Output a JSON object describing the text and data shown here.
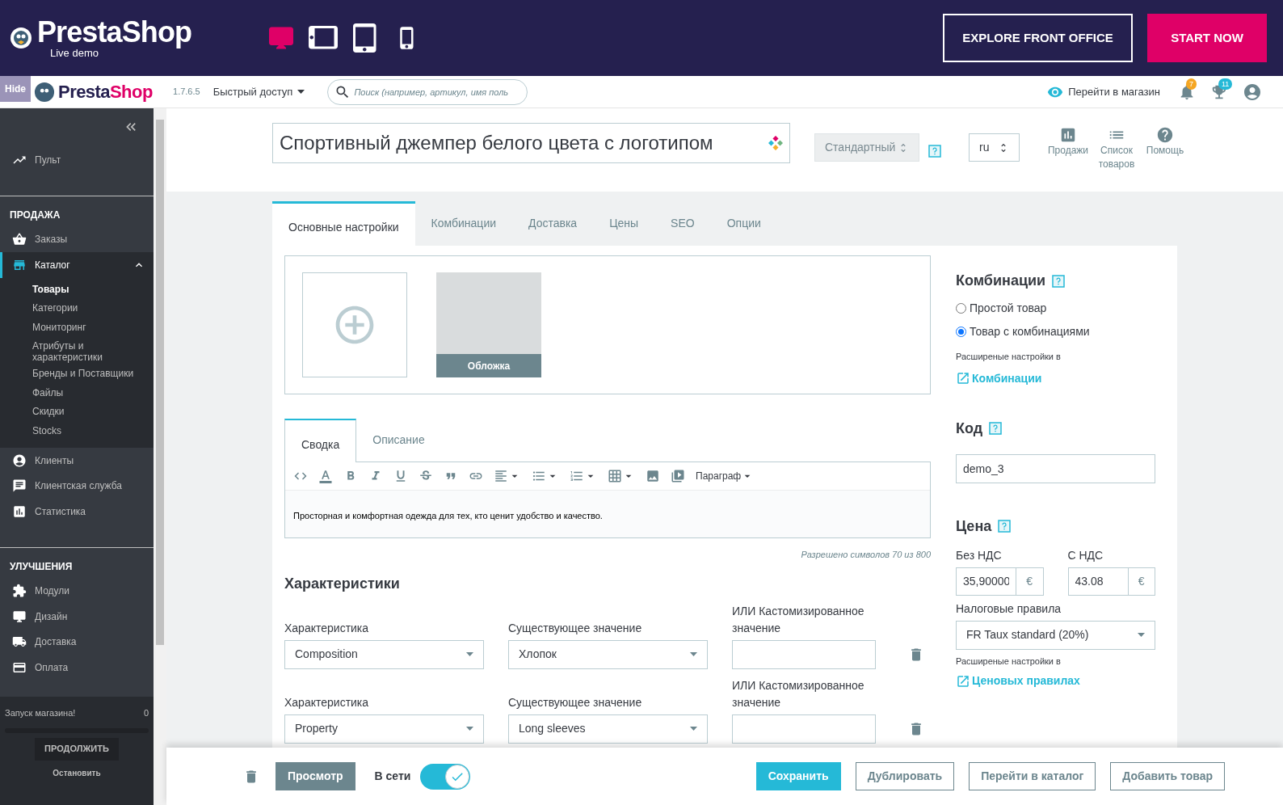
{
  "demo_bar": {
    "logo": "PrestaShop",
    "subtitle": "Live demo",
    "devices": [
      {
        "kind": "desktop",
        "selected": true
      },
      {
        "kind": "tablet-landscape",
        "selected": false
      },
      {
        "kind": "tablet",
        "selected": false
      },
      {
        "kind": "phone",
        "selected": false
      }
    ],
    "buttons": [
      {
        "label": "EXPLORE FRONT OFFICE",
        "kind": "outline"
      },
      {
        "label": "START NOW",
        "kind": "primary"
      }
    ]
  },
  "header": {
    "hide_label": "Hide",
    "logo_part1": "Presta",
    "logo_part2": "Shop",
    "version": "1.7.6.5",
    "quick_access": "Быстрый доступ",
    "search_placeholder": "Поиск (например, артикул, имя поль",
    "view_shop": "Перейти в магазин",
    "notifications": [
      {
        "kind": "bell",
        "count": "7",
        "color": "#f5a623"
      },
      {
        "kind": "trophy",
        "count": "11",
        "color": "#25b9d7"
      }
    ]
  },
  "sidebar": {
    "groups": [
      {
        "items": [
          {
            "kind": "dashboard",
            "label": "Пульт",
            "selected": false
          }
        ]
      },
      {
        "title": "ПРОДАЖА",
        "items": [
          {
            "kind": "orders",
            "label": "Заказы",
            "selected": false
          },
          {
            "kind": "catalog",
            "label": "Каталог",
            "selected": true,
            "expanded": true,
            "children": [
              {
                "label": "Товары",
                "selected": true
              },
              {
                "label": "Категории",
                "selected": false
              },
              {
                "label": "Мониторинг",
                "selected": false
              },
              {
                "label": "Атрибуты и характеристики",
                "selected": false
              },
              {
                "label": "Бренды и Поставщики",
                "selected": false
              },
              {
                "label": "Файлы",
                "selected": false
              },
              {
                "label": "Скидки",
                "selected": false
              },
              {
                "label": "Stocks",
                "selected": false
              }
            ]
          },
          {
            "kind": "customers",
            "label": "Клиенты",
            "selected": false
          },
          {
            "kind": "support",
            "label": "Клиентская служба",
            "selected": false
          },
          {
            "kind": "stats",
            "label": "Статистика",
            "selected": false
          }
        ]
      },
      {
        "title": "УЛУЧШЕНИЯ",
        "items": [
          {
            "kind": "modules",
            "label": "Модули",
            "selected": false
          },
          {
            "kind": "design",
            "label": "Дизайн",
            "selected": false
          },
          {
            "kind": "shipping",
            "label": "Доставка",
            "selected": false
          },
          {
            "kind": "payment",
            "label": "Оплата",
            "selected": false
          }
        ]
      }
    ],
    "launch": {
      "label": "Запуск магазина!",
      "percent": "0",
      "level": 0,
      "button": "ПРОДОЛЖИТЬ",
      "stop": "Остановить"
    }
  },
  "product": {
    "name": "Спортивный джемпер белого цвета с логотипом",
    "type": "Стандартный",
    "language": "ru",
    "tools": [
      {
        "kind": "sales",
        "label": "Продажи"
      },
      {
        "kind": "list",
        "label": "Список товаров"
      },
      {
        "kind": "help",
        "label": "Помощь"
      }
    ]
  },
  "tabs": [
    {
      "label": "Основные настройки",
      "selected": true
    },
    {
      "label": "Комбинации",
      "selected": false
    },
    {
      "label": "Доставка",
      "selected": false
    },
    {
      "label": "Цены",
      "selected": false
    },
    {
      "label": "SEO",
      "selected": false
    },
    {
      "label": "Опции",
      "selected": false
    }
  ],
  "images": {
    "cover_caption": "Обложка"
  },
  "editor": {
    "tabs": [
      {
        "label": "Сводка",
        "selected": true
      },
      {
        "label": "Описание",
        "selected": false
      }
    ],
    "paragraph": "Параграф",
    "content": "Просторная и комфортная одежда для тех, кто ценит удобство и качество.",
    "counter": "Разрешено символов 70 из 800"
  },
  "features": {
    "title": "Характеристики",
    "rows": [
      {
        "feature_label": "Характеристика",
        "feature": "Composition",
        "value_label": "Существующее значение",
        "value": "Хлопок",
        "custom_label": "ИЛИ Кастомизированное значение"
      },
      {
        "feature_label": "Характеристика",
        "feature": "Property",
        "value_label": "Существующее значение",
        "value": "Long sleeves",
        "custom_label": "ИЛИ Кастомизированное значение"
      }
    ]
  },
  "combinations": {
    "title": "Комбинации",
    "options": [
      {
        "label": "Простой товар",
        "selected": false
      },
      {
        "label": "Товар с комбинациями",
        "selected": true
      }
    ],
    "note": "Расширеные настройки в",
    "link": "Комбинации"
  },
  "code": {
    "title": "Код",
    "value": "demo_3"
  },
  "price": {
    "title": "Цена",
    "fields": [
      {
        "label": "Без НДС",
        "value": "35,90000",
        "currency": "€"
      },
      {
        "label": "С НДС",
        "value": "43.08",
        "currency": "€"
      }
    ],
    "tax_label": "Налоговые правила",
    "tax": "FR Taux standard (20%)",
    "note": "Расширеные настройки в",
    "link": "Ценовых правилах"
  },
  "footer": {
    "preview": "Просмотр",
    "online_label": "В сети",
    "online": true,
    "buttons": [
      {
        "label": "Сохранить",
        "kind": "primary"
      },
      {
        "label": "Дублировать",
        "kind": "outline"
      },
      {
        "label": "Перейти в каталог",
        "kind": "outline"
      },
      {
        "label": "Добавить товар",
        "kind": "outline"
      }
    ]
  }
}
